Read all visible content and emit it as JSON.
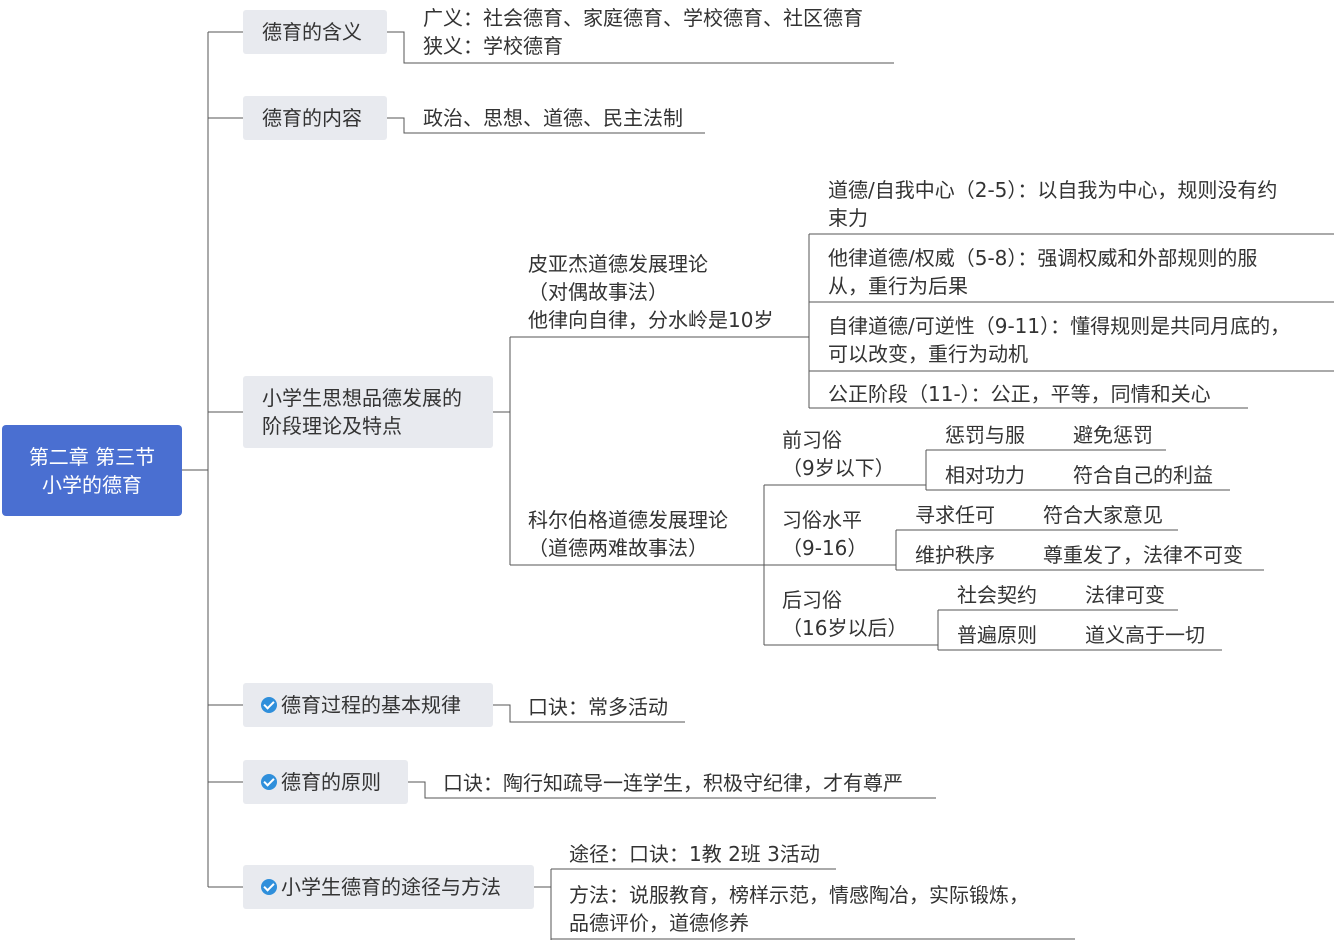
{
  "root": {
    "label": "第二章 第三节\n小学的德育"
  },
  "branches": {
    "meaning": {
      "label": "德育的含义"
    },
    "content": {
      "label": "德育的内容"
    },
    "theory": {
      "label": "小学生思想品德发展的\n阶段理论及特点"
    },
    "law": {
      "label": "德育过程的基本规律"
    },
    "principle": {
      "label": "德育的原则"
    },
    "method": {
      "label": "小学生德育的途径与方法"
    }
  },
  "meaning": {
    "broad": "广义：社会德育、家庭德育、学校德育、社区德育",
    "narrow": "狭义：学校德育"
  },
  "content": {
    "text": "政治、思想、道德、民主法制"
  },
  "piaget": {
    "title": "皮亚杰道德发展理论",
    "subtitle": "（对偶故事法）",
    "note": "他律向自律，分水岭是10岁",
    "stages": [
      {
        "line1": "道德/自我中心（2-5）：以自我为中心，规则没有约",
        "line2": "束力"
      },
      {
        "line1": "他律道德/权威（5-8）：强调权威和外部规则的服",
        "line2": "从，重行为后果"
      },
      {
        "line1": "自律道德/可逆性（9-11）：懂得规则是共同月底的，",
        "line2": "可以改变，重行为动机"
      },
      {
        "line1": "公正阶段（11-）：公正，平等，同情和关心",
        "line2": ""
      }
    ]
  },
  "kohlberg": {
    "title": "科尔伯格道德发展理论",
    "subtitle": "（道德两难故事法）",
    "levels": [
      {
        "name": "前习俗",
        "age": "（9岁以下）",
        "stages": [
          {
            "a": "惩罚与服",
            "b": "避免惩罚"
          },
          {
            "a": "相对功力",
            "b": "符合自己的利益"
          }
        ]
      },
      {
        "name": "习俗水平",
        "age": "（9-16）",
        "stages": [
          {
            "a": "寻求任可",
            "b": "符合大家意见"
          },
          {
            "a": "维护秩序",
            "b": "尊重发了，法律不可变"
          }
        ]
      },
      {
        "name": "后习俗",
        "age": "（16岁以后）",
        "stages": [
          {
            "a": "社会契约",
            "b": "法律可变"
          },
          {
            "a": "普遍原则",
            "b": "道义高于一切"
          }
        ]
      }
    ]
  },
  "law": {
    "text": "口诀：常多活动"
  },
  "principle": {
    "text": "口诀：陶行知疏导一连学生，积极守纪律，才有尊严"
  },
  "method": {
    "way": "途径：口诀：1教 2班 3活动",
    "method_line1": "方法：说服教育，榜样示范，情感陶冶，实际锻炼，",
    "method_line2": "品德评价，道德修养"
  },
  "colors": {
    "root_fill": "#4a6fd1",
    "branch_fill": "#e8eaef",
    "line": "#555555",
    "check_icon": "#2f8fdb"
  }
}
